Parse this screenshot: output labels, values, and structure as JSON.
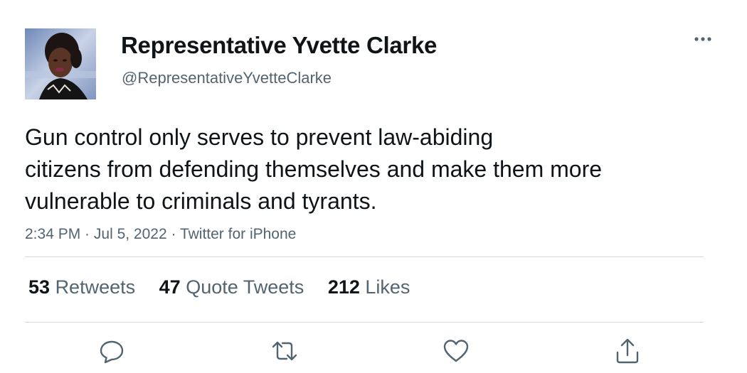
{
  "tweet": {
    "author": {
      "display_name": "Representative Yvette Clarke",
      "handle": "@RepresentativeYvetteClarke",
      "avatar_icon": "profile-photo"
    },
    "text_lines": [
      "Gun control only serves to prevent law-abiding",
      "citizens from defending themselves and make them more",
      "vulnerable to criminals and tyrants."
    ],
    "time": "2:34 PM",
    "separator": " · ",
    "date": "Jul 5, 2022",
    "source": "Twitter for iPhone",
    "stats": {
      "retweets": {
        "count": "53",
        "label": "Retweets"
      },
      "quote_tweets": {
        "count": "47",
        "label": "Quote Tweets"
      },
      "likes": {
        "count": "212",
        "label": "Likes"
      }
    },
    "actions": [
      "reply-icon",
      "retweet-icon",
      "like-icon",
      "share-icon"
    ],
    "more_icon": "more-horizontal-icon"
  },
  "colors": {
    "text_primary": "#0f1419",
    "text_secondary": "#536471",
    "divider": "#cfd9de",
    "background": "#ffffff"
  }
}
